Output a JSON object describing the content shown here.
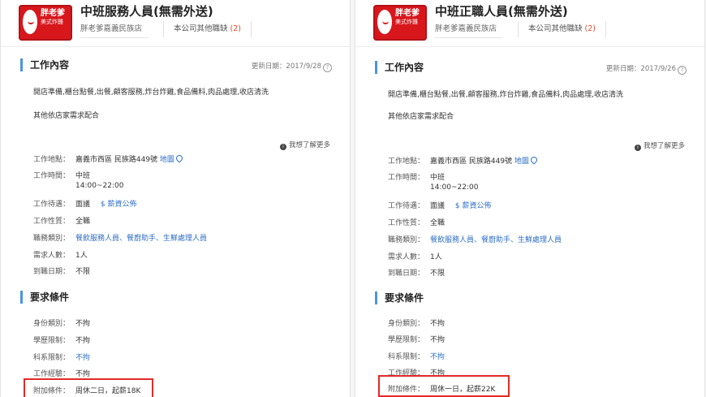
{
  "panels": [
    {
      "logo": {
        "line1": "胖老爹",
        "line2": "美式炸雞"
      },
      "job_title": "中班服務人員(無需外送)",
      "company": "胖老爹嘉義民族店",
      "other_jobs_label": "本公司其他職缺",
      "other_jobs_count": "(2)",
      "section_work": "工作內容",
      "updated": "更新日期：2017/9/28",
      "desc1": "開店準備,櫃台點餐,出餐,顧客服務,炸台炸雞,食品備料,肉品處理,收店清洗",
      "desc2": "其他依店家需求配合",
      "learn_more": "我想了解更多",
      "details": [
        {
          "label": "工作地點：",
          "value": "嘉義市西區 民族路449號",
          "link": "地圖"
        },
        {
          "label": "工作時間：",
          "value": "中班",
          "value2": "14:00~22:00"
        },
        {
          "label": "工作待遇：",
          "value": "面議",
          "link": "$ 薪資公佈"
        },
        {
          "label": "工作性質：",
          "value": "全職"
        },
        {
          "label": "職務類別：",
          "link": "餐飲服務人員、餐廚助手、生鮮處理人員"
        },
        {
          "label": "需求人數：",
          "value": "1人"
        },
        {
          "label": "到職日期：",
          "value": "不限"
        }
      ],
      "section_req": "要求條件",
      "requirements": [
        {
          "label": "身份類別：",
          "value": "不拘"
        },
        {
          "label": "學歷限制：",
          "value": "不拘"
        },
        {
          "label": "科系限制：",
          "link": "不拘"
        },
        {
          "label": "工作經驗：",
          "value": "不拘"
        },
        {
          "label": "附加條件：",
          "value": "周休二日，起薪18K"
        }
      ]
    },
    {
      "logo": {
        "line1": "胖老爹",
        "line2": "美式炸雞"
      },
      "job_title": "中班正職人員(無需外送)",
      "company": "胖老爹嘉義民族店",
      "other_jobs_label": "本公司其他職缺",
      "other_jobs_count": "(2)",
      "section_work": "工作內容",
      "updated": "更新日期：2017/9/26",
      "desc1": "開店準備,櫃台點餐,出餐,顧客服務,炸台炸雞,食品備料,肉品處理,收店清洗",
      "desc2": "其他依店家需求配合",
      "learn_more": "我想了解更多",
      "details": [
        {
          "label": "工作地點：",
          "value": "嘉義市西區 民族路449號",
          "link": "地圖"
        },
        {
          "label": "工作時間：",
          "value": "中班",
          "value2": "14:00~22:00"
        },
        {
          "label": "工作待遇：",
          "value": "面議",
          "link": "$ 薪資公佈"
        },
        {
          "label": "工作性質：",
          "value": "全職"
        },
        {
          "label": "職務類別：",
          "link": "餐飲服務人員、餐廚助手、生鮮處理人員"
        },
        {
          "label": "需求人數：",
          "value": "1人"
        },
        {
          "label": "到職日期：",
          "value": "不限"
        }
      ],
      "section_req": "要求條件",
      "requirements": [
        {
          "label": "身份類別：",
          "value": "不拘"
        },
        {
          "label": "學歷限制：",
          "value": "不拘"
        },
        {
          "label": "科系限制：",
          "link": "不拘"
        },
        {
          "label": "工作經驗：",
          "value": "不拘"
        },
        {
          "label": "附加條件：",
          "value": "周休一日，起薪22K"
        }
      ]
    }
  ],
  "colors": {
    "brand_red": "#d8171d",
    "accent_blue": "#4b96d8",
    "link_blue": "#2f6fc4",
    "highlight_red": "#e22a2a"
  }
}
